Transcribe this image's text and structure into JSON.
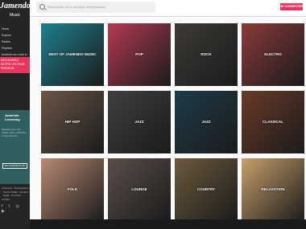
{
  "brand": {
    "name": "Jamendo",
    "sub": "Music"
  },
  "sidebar": {
    "items": [
      "Home",
      "Explore",
      "Radios",
      "Playlists"
    ],
    "link": "Jamendo sur votre tv",
    "cta": "DÉCOUVREZ NOTRE LECTEUR PREMIUM",
    "licensing": {
      "title": "Jamendo Licensing",
      "text": "Musique pour vos vidéos, films, publicités et événements",
      "button": "EN SAVOIR PLUS"
    },
    "footer": "Licensing · Développeurs · Centre d'aide · Contact · Légal · À propos · Langue",
    "social": "f t ◎ ▶"
  },
  "search": {
    "placeholder": "Rechercher de la musique indépendante"
  },
  "signup": "SE CONNECTER",
  "tiles": [
    {
      "label": "BEST OF JAMENDO MUSIC",
      "bg": "#1e7f8f"
    },
    {
      "label": "POP",
      "bg": "#b33a53"
    },
    {
      "label": "ROCK",
      "bg": "#3d3a36"
    },
    {
      "label": "ELECTRO",
      "bg": "#8a3a3a"
    },
    {
      "label": "HIP HOP",
      "bg": "#6b5646"
    },
    {
      "label": "JAZZ",
      "bg": "#3f3f3f"
    },
    {
      "label": "JAZZ",
      "bg": "#1d3b4a"
    },
    {
      "label": "CLASSICAL",
      "bg": "#6a3a28"
    },
    {
      "label": "FOLK",
      "bg": "#b98a74"
    },
    {
      "label": "LOUNGE",
      "bg": "#5a4e4a"
    },
    {
      "label": "COUNTRY",
      "bg": "#6c5a3c"
    },
    {
      "label": "RELAXATION",
      "bg": "#c9a16c"
    }
  ]
}
